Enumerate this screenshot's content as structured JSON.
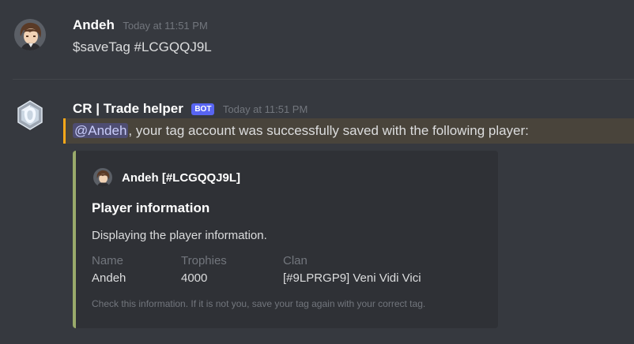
{
  "message1": {
    "username": "Andeh",
    "timestamp": "Today at 11:51 PM",
    "content": "$saveTag #LCGQQJ9L",
    "avatar_icon": "anime-character-avatar"
  },
  "message2": {
    "username": "CR | Trade helper",
    "bot_tag": "BOT",
    "timestamp": "Today at 11:51 PM",
    "mention": "@Andeh",
    "content": ", your tag account was successfully saved with the following player:",
    "avatar_icon": "crystal-badge-avatar",
    "highlight_color": "#faa81a"
  },
  "embed": {
    "accent_color": "#99aa6b",
    "author": "Andeh [#LCGQQJ9L]",
    "title": "Player information",
    "description": "Displaying the player information.",
    "fields": [
      {
        "name": "Name",
        "value": "Andeh"
      },
      {
        "name": "Trophies",
        "value": "4000"
      },
      {
        "name": "Clan",
        "value": "[#9LPRGP9] Veni Vidi Vici"
      }
    ],
    "footer": "Check this information. If it is not you, save your tag again with your correct tag."
  }
}
